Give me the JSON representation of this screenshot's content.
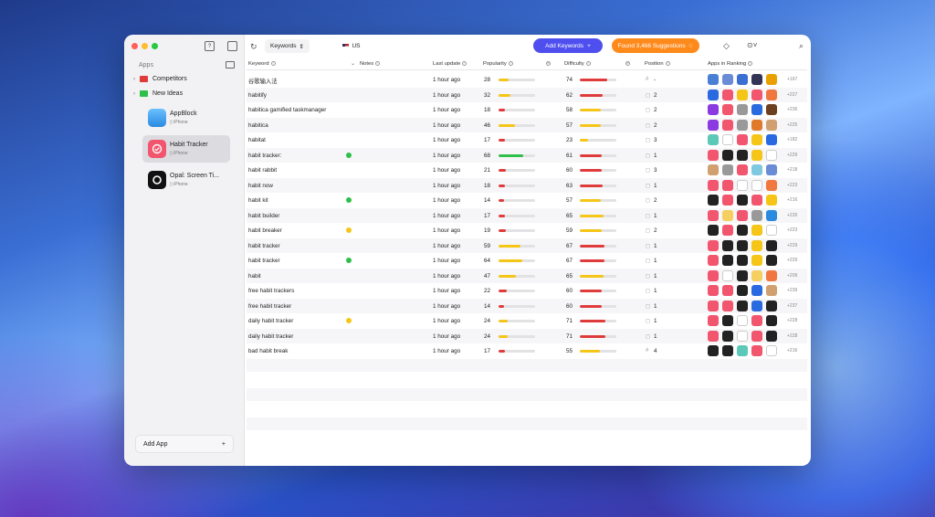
{
  "sidebar": {
    "apps_label": "Apps",
    "folders": [
      {
        "label": "Competitors",
        "color": "#e03b3b"
      },
      {
        "label": "New Ideas",
        "color": "#2fbf4a"
      }
    ],
    "apps": [
      {
        "name": "AppBlock",
        "platform": "iPhone",
        "color": "#4aa3f0"
      },
      {
        "name": "Habit Tracker",
        "platform": "iPhone",
        "color": "#f2556e"
      },
      {
        "name": "Opal: Screen Ti...",
        "platform": "iPhone",
        "color": "#111111"
      }
    ],
    "add_app": "Add App",
    "add_plus": "+"
  },
  "toolbar": {
    "keywords_dropdown": "Keywords",
    "store": "US",
    "add_keywords": "Add Keywords",
    "found_suggestions": "Found 3,466 Suggestions"
  },
  "table": {
    "headers": {
      "keyword": "Keyword",
      "notes": "Notes",
      "last_update": "Last update",
      "popularity": "Popularity",
      "difficulty": "Difficulty",
      "position": "Position",
      "apps_in_ranking": "Apps in Ranking"
    },
    "rows": [
      {
        "keyword": "谷歌输入法",
        "note": "",
        "updated": "1 hour ago",
        "pop": 28,
        "popc": "#f5c518",
        "diff": 74,
        "diffc": "#e03b3b",
        "pos_icon": "#",
        "pos": "-",
        "more": "+167",
        "icons": [
          "#4a7fd6",
          "#6a8bd6",
          "#3b6fd4",
          "#335",
          "#e8a100"
        ]
      },
      {
        "keyword": "habitify",
        "note": "",
        "updated": "1 hour ago",
        "pop": 32,
        "popc": "#f5c518",
        "diff": 62,
        "diffc": "#e03b3b",
        "pos_icon": "◻",
        "pos": "2",
        "more": "+227",
        "icons": [
          "#2a6ae0",
          "#f2556e",
          "#f5c518",
          "#f2556e",
          "#f07840"
        ]
      },
      {
        "keyword": "habitica gamified taskmanager",
        "note": "",
        "updated": "1 hour ago",
        "pop": 18,
        "popc": "#e03b3b",
        "diff": 58,
        "diffc": "#f5c518",
        "pos_icon": "◻",
        "pos": "2",
        "more": "+236",
        "icons": [
          "#8a3ae0",
          "#f2556e",
          "#999",
          "#2a6ae0",
          "#6b3f1f"
        ]
      },
      {
        "keyword": "habitica",
        "note": "",
        "updated": "1 hour ago",
        "pop": 46,
        "popc": "#f5c518",
        "diff": 57,
        "diffc": "#f5c518",
        "pos_icon": "◻",
        "pos": "2",
        "more": "+225",
        "icons": [
          "#8a3ae0",
          "#f2556e",
          "#999",
          "#e07a2a",
          "#d0a070"
        ]
      },
      {
        "keyword": "habitat",
        "note": "",
        "updated": "1 hour ago",
        "pop": 17,
        "popc": "#e03b3b",
        "diff": 23,
        "diffc": "#f5c518",
        "pos_icon": "◻",
        "pos": "3",
        "more": "+182",
        "icons": [
          "#5cc8b8",
          "#fff",
          "#f2556e",
          "#f5c518",
          "#2a6ae0"
        ]
      },
      {
        "keyword": "habit tracker:",
        "note": "#2fbf4a",
        "updated": "1 hour ago",
        "pop": 68,
        "popc": "#2fbf4a",
        "diff": 61,
        "diffc": "#e03b3b",
        "pos_icon": "◻",
        "pos": "1",
        "more": "+229",
        "icons": [
          "#f2556e",
          "#222",
          "#222",
          "#f5c518",
          "#fff"
        ]
      },
      {
        "keyword": "habit rabbit",
        "note": "",
        "updated": "1 hour ago",
        "pop": 21,
        "popc": "#e03b3b",
        "diff": 60,
        "diffc": "#e03b3b",
        "pos_icon": "◻",
        "pos": "3",
        "more": "+218",
        "icons": [
          "#d0a070",
          "#999",
          "#f2556e",
          "#7ec8e0",
          "#6a8bd6"
        ]
      },
      {
        "keyword": "habit now",
        "note": "",
        "updated": "1 hour ago",
        "pop": 18,
        "popc": "#e03b3b",
        "diff": 63,
        "diffc": "#e03b3b",
        "pos_icon": "◻",
        "pos": "1",
        "more": "+223",
        "icons": [
          "#f2556e",
          "#f2556e",
          "#fff",
          "#fff",
          "#f07840"
        ]
      },
      {
        "keyword": "habit kit",
        "note": "#2fbf4a",
        "updated": "1 hour ago",
        "pop": 14,
        "popc": "#e03b3b",
        "diff": 57,
        "diffc": "#f5c518",
        "pos_icon": "◻",
        "pos": "2",
        "more": "+216",
        "icons": [
          "#222",
          "#f2556e",
          "#222",
          "#f2556e",
          "#f5c518"
        ]
      },
      {
        "keyword": "habit builder",
        "note": "",
        "updated": "1 hour ago",
        "pop": 17,
        "popc": "#e03b3b",
        "diff": 65,
        "diffc": "#f5c518",
        "pos_icon": "◻",
        "pos": "1",
        "more": "+226",
        "icons": [
          "#f2556e",
          "#f5d060",
          "#f2556e",
          "#999",
          "#2a8ae0"
        ]
      },
      {
        "keyword": "habit breaker",
        "note": "#f5c518",
        "updated": "1 hour ago",
        "pop": 19,
        "popc": "#e03b3b",
        "diff": 59,
        "diffc": "#f5c518",
        "pos_icon": "◻",
        "pos": "2",
        "more": "+223",
        "icons": [
          "#222",
          "#f2556e",
          "#222",
          "#f5c518",
          "#fff"
        ]
      },
      {
        "keyword": "habit  tracker",
        "note": "",
        "updated": "1 hour ago",
        "pop": 59,
        "popc": "#f5c518",
        "diff": 67,
        "diffc": "#e03b3b",
        "pos_icon": "◻",
        "pos": "1",
        "more": "+229",
        "icons": [
          "#f2556e",
          "#222",
          "#222",
          "#f5c518",
          "#222"
        ]
      },
      {
        "keyword": "habit   tracker",
        "note": "#2fbf4a",
        "updated": "1 hour ago",
        "pop": 64,
        "popc": "#f5c518",
        "diff": 67,
        "diffc": "#e03b3b",
        "pos_icon": "◻",
        "pos": "1",
        "more": "+229",
        "icons": [
          "#f2556e",
          "#222",
          "#222",
          "#f5c518",
          "#222"
        ]
      },
      {
        "keyword": "habit",
        "note": "",
        "updated": "1 hour ago",
        "pop": 47,
        "popc": "#f5c518",
        "diff": 65,
        "diffc": "#f5c518",
        "pos_icon": "◻",
        "pos": "1",
        "more": "+209",
        "icons": [
          "#f2556e",
          "#fff",
          "#222",
          "#f5d060",
          "#f07840"
        ]
      },
      {
        "keyword": "free habit trackers",
        "note": "",
        "updated": "1 hour ago",
        "pop": 22,
        "popc": "#e03b3b",
        "diff": 60,
        "diffc": "#e03b3b",
        "pos_icon": "◻",
        "pos": "1",
        "more": "+239",
        "icons": [
          "#f2556e",
          "#f2556e",
          "#222",
          "#2a6ae0",
          "#d0a070"
        ]
      },
      {
        "keyword": "free habit tracker",
        "note": "",
        "updated": "1 hour ago",
        "pop": 14,
        "popc": "#e03b3b",
        "diff": 60,
        "diffc": "#e03b3b",
        "pos_icon": "◻",
        "pos": "1",
        "more": "+237",
        "icons": [
          "#f2556e",
          "#f2556e",
          "#222",
          "#2a6ae0",
          "#222"
        ]
      },
      {
        "keyword": "daily habit tracker",
        "note": "#f5c518",
        "updated": "1 hour ago",
        "pop": 24,
        "popc": "#f5c518",
        "diff": 71,
        "diffc": "#e03b3b",
        "pos_icon": "◻",
        "pos": "1",
        "more": "+228",
        "icons": [
          "#f2556e",
          "#222",
          "#fff",
          "#f2556e",
          "#222"
        ]
      },
      {
        "keyword": "daily habit  tracker",
        "note": "",
        "updated": "1 hour ago",
        "pop": 24,
        "popc": "#f5c518",
        "diff": 71,
        "diffc": "#e03b3b",
        "pos_icon": "◻",
        "pos": "1",
        "more": "+228",
        "icons": [
          "#f2556e",
          "#222",
          "#fff",
          "#f2556e",
          "#222"
        ]
      },
      {
        "keyword": "bad habit break",
        "note": "",
        "updated": "1 hour ago",
        "pop": 17,
        "popc": "#e03b3b",
        "diff": 55,
        "diffc": "#f5c518",
        "pos_icon": "#",
        "pos": "4",
        "more": "+216",
        "icons": [
          "#222",
          "#222",
          "#5cc8b8",
          "#f2556e",
          "#fff"
        ]
      }
    ]
  }
}
